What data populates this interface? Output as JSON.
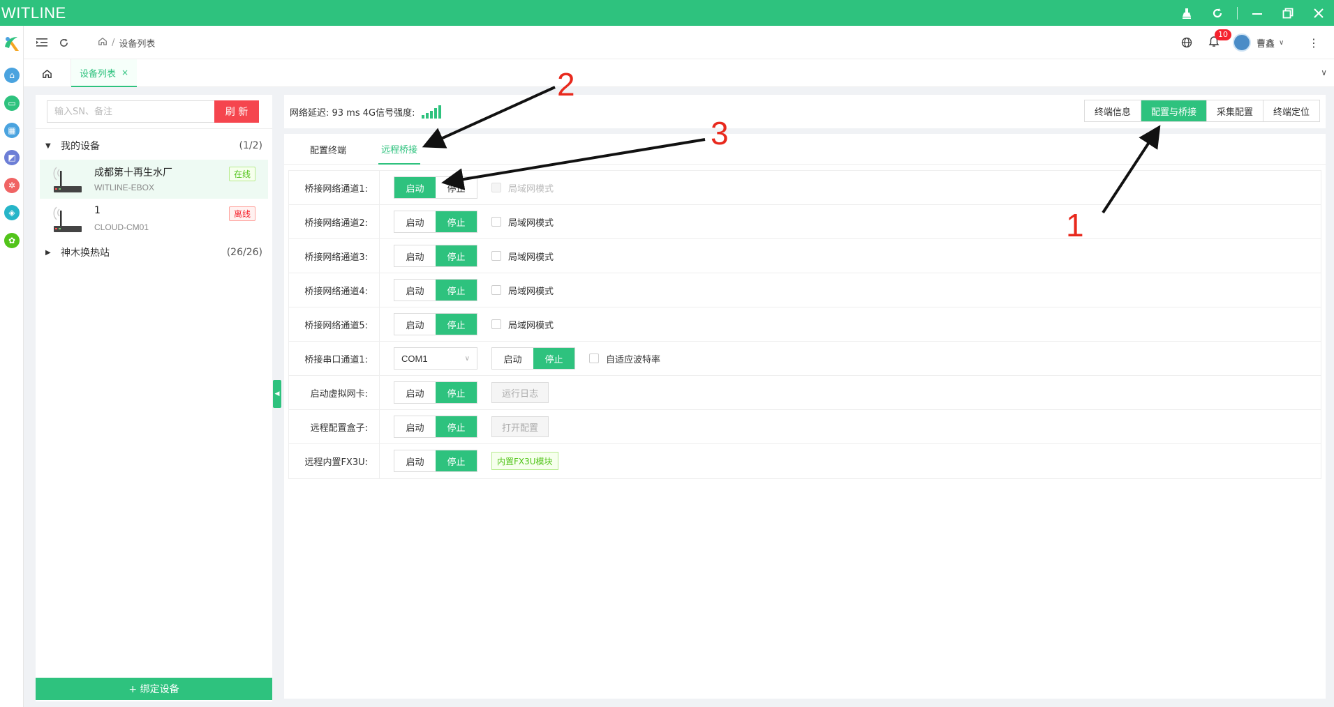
{
  "window": {
    "title": "WITLINE"
  },
  "header": {
    "breadcrumb": "设备列表",
    "crumb_sep": "/",
    "notifications_count": "10",
    "user_name": "曹鑫"
  },
  "tabs": {
    "active_label": "设备列表",
    "close": "×"
  },
  "sidebar": {
    "search_placeholder": "输入SN、备注",
    "refresh_label": "刷 新",
    "groups": [
      {
        "name": "我的设备",
        "count": "(1/2)",
        "expanded": true
      },
      {
        "name": "神木换热站",
        "count": "(26/26)",
        "expanded": false
      }
    ],
    "devices": [
      {
        "name": "成都第十再生水厂",
        "sn": "WITLINE-EBOX",
        "status": "在线"
      },
      {
        "name": "1",
        "sn": "CLOUD-CM01",
        "status": "离线"
      }
    ],
    "bind_label": "+ 绑定设备"
  },
  "main": {
    "latency_text": "网络延迟: 93 ms 4G信号强度:",
    "signal_bars": 5,
    "top_tabs": [
      "终端信息",
      "配置与桥接",
      "采集配置",
      "终端定位"
    ],
    "active_top_tab": "配置与桥接",
    "sub_tabs": [
      "配置终端",
      "远程桥接"
    ],
    "active_sub_tab": "远程桥接",
    "start_label": "启动",
    "stop_label": "停止",
    "lan_mode_label": "局域网模式",
    "rows": [
      {
        "label": "桥接网络通道1:",
        "state": "启动"
      },
      {
        "label": "桥接网络通道2:",
        "state": "停止"
      },
      {
        "label": "桥接网络通道3:",
        "state": "停止"
      },
      {
        "label": "桥接网络通道4:",
        "state": "停止"
      },
      {
        "label": "桥接网络通道5:",
        "state": "停止"
      },
      {
        "label": "桥接串口通道1:",
        "state": "停止"
      },
      {
        "label": "启动虚拟网卡:",
        "state": "停止"
      },
      {
        "label": "远程配置盒子:",
        "state": "停止"
      },
      {
        "label": "远程内置FX3U:",
        "state": "停止"
      }
    ],
    "serial_select_value": "COM1",
    "adaptive_baud_label": "自适应波特率",
    "run_log_label": "运行日志",
    "open_config_label": "打开配置",
    "fx3u_tag": "内置FX3U模块"
  },
  "annotations": [
    "1",
    "2",
    "3"
  ],
  "colors": {
    "primary": "#2ec27e",
    "danger": "#f5454e",
    "annotation": "#e8291d"
  }
}
